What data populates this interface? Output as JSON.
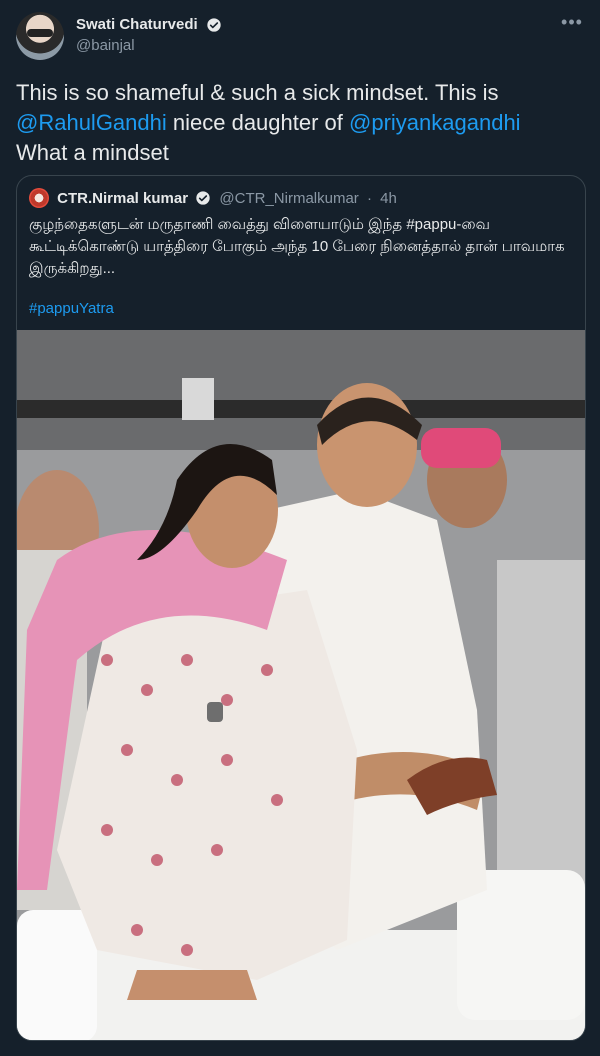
{
  "author": {
    "display_name": "Swati Chaturvedi",
    "handle": "@bainjal",
    "verified_icon": "verified-badge-icon",
    "more_icon": "more-horizontal-icon"
  },
  "tweet": {
    "part1": "This is so shameful & such a sick mindset. This is ",
    "mention1": "@RahulGandhi",
    "part2": " niece daughter of ",
    "mention2": "@priyankagandhi",
    "part3": "What a mindset"
  },
  "quote": {
    "display_name": "CTR.Nirmal kumar",
    "handle": "@CTR_Nirmalkumar",
    "separator": "·",
    "time": "4h",
    "text": "குழந்தைகளுடன் மருதாணி வைத்து விளையாடும் இந்த #pappu-வை கூட்டிக்கொண்டு யாத்திரை போகும் அந்த 10 பேரை நினைத்தால் தான் பாவமாக இருக்கிறது...",
    "hashtag": "#pappuYatra",
    "image_alt": "photo"
  },
  "colors": {
    "background": "#15202b",
    "text": "#e7e9ea",
    "muted": "#8b98a5",
    "link": "#1d9bf0",
    "border": "#38444d"
  }
}
